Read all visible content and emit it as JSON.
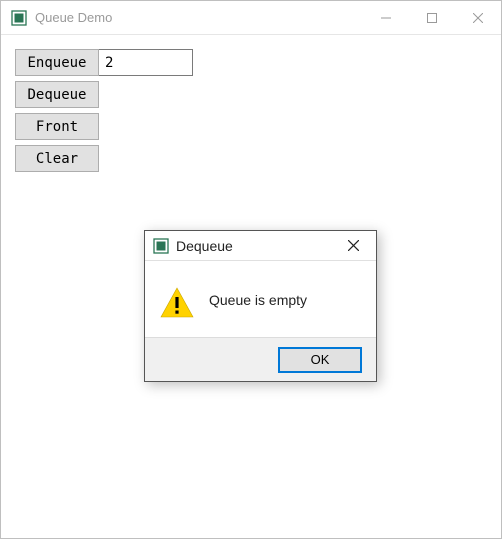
{
  "window": {
    "title": "Queue Demo"
  },
  "buttons": {
    "enqueue": "Enqueue",
    "dequeue": "Dequeue",
    "front": "Front",
    "clear": "Clear"
  },
  "input": {
    "value": "2"
  },
  "dialog": {
    "title": "Dequeue",
    "message": "Queue is empty",
    "ok": "OK"
  }
}
